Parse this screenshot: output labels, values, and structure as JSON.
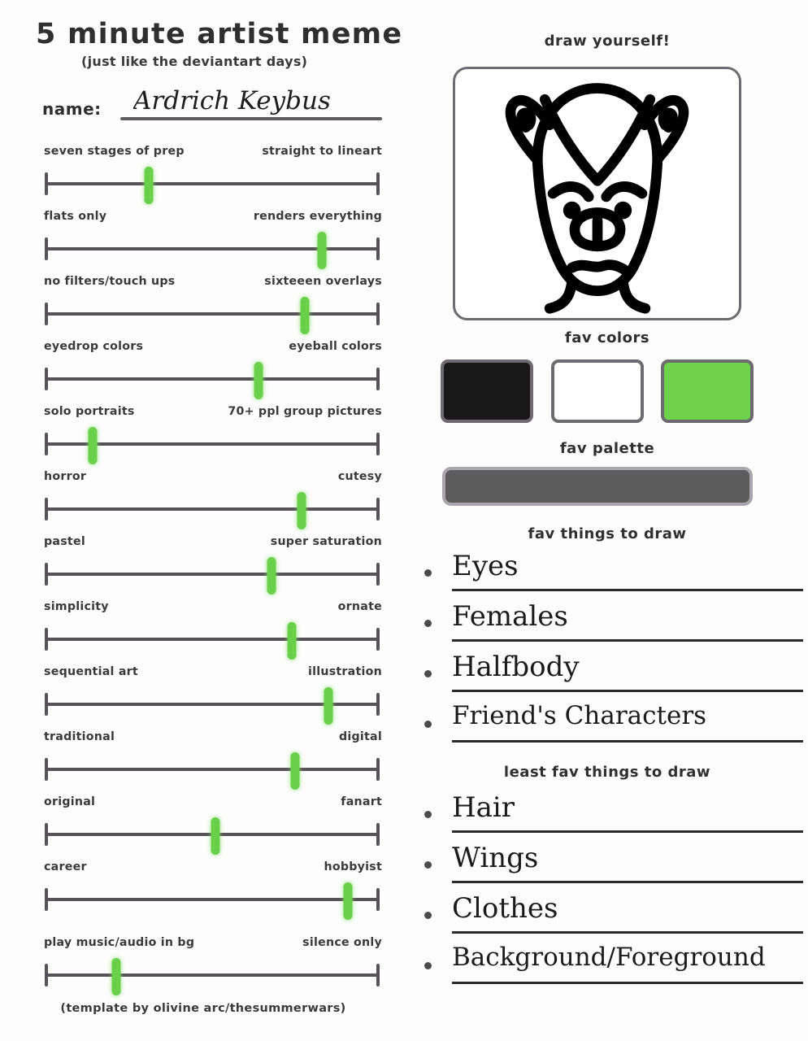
{
  "header": {
    "title": "5 minute artist meme",
    "subtitle": "(just like the deviantart days)",
    "name_label": "name:",
    "name_value": "Ardrich Keybus"
  },
  "sliders": [
    {
      "left": "seven stages of prep",
      "right": "straight to lineart",
      "value": 31
    },
    {
      "left": "flats only",
      "right": "renders everything",
      "value": 83
    },
    {
      "left": "no filters/touch ups",
      "right": "sixteeen overlays",
      "value": 78
    },
    {
      "left": "eyedrop colors",
      "right": "eyeball colors",
      "value": 64
    },
    {
      "left": "solo portraits",
      "right": "70+ ppl group pictures",
      "value": 14
    },
    {
      "left": "horror",
      "right": "cutesy",
      "value": 77
    },
    {
      "left": "pastel",
      "right": "super saturation",
      "value": 68
    },
    {
      "left": "simplicity",
      "right": "ornate",
      "value": 74
    },
    {
      "left": "sequential art",
      "right": "illustration",
      "value": 85
    },
    {
      "left": "traditional",
      "right": "digital",
      "value": 75
    },
    {
      "left": "original",
      "right": "fanart",
      "value": 51
    },
    {
      "left": "career",
      "right": "hobbyist",
      "value": 91
    },
    {
      "left": "play music/audio in bg",
      "right": "silence only",
      "value": 21
    }
  ],
  "right": {
    "draw_yourself_label": "draw yourself!",
    "drawing_name": "self-portrait-drawing",
    "fav_colors_label": "fav colors",
    "fav_colors": [
      {
        "name": "black-swatch",
        "hex": "#181818"
      },
      {
        "name": "white-swatch",
        "hex": "#ffffff"
      },
      {
        "name": "green-swatch",
        "hex": "#6fd24d"
      }
    ],
    "fav_palette_label": "fav palette",
    "fav_palette_color": "#5c5c5c",
    "fav_things_label": "fav things to draw",
    "fav_things": [
      "Eyes",
      "Females",
      "Halfbody",
      "Friend's Characters"
    ],
    "least_fav_label": "least fav things to draw",
    "least_fav_things": [
      "Hair",
      "Wings",
      "Clothes",
      "Background/Foreground"
    ]
  },
  "footer": {
    "credit": "(template by olivine arc/thesummerwars)"
  },
  "theme": {
    "marker_green": "#6ad04c",
    "track_gray": "#575258",
    "text_dark": "#3a3a3a"
  }
}
